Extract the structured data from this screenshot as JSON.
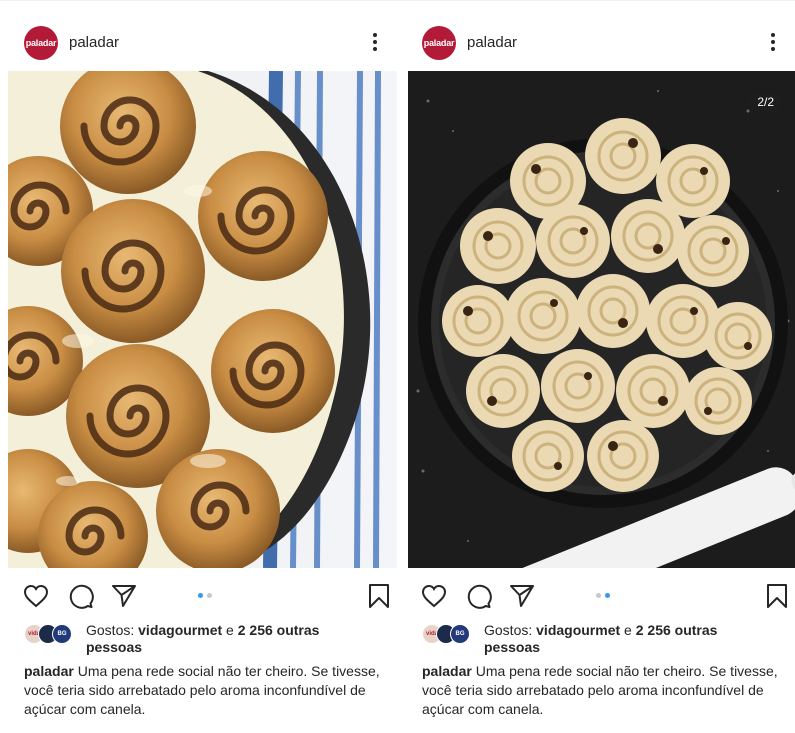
{
  "posts": [
    {
      "account": {
        "username": "paladar",
        "avatar_text": "paladar"
      },
      "image": {
        "description_icon": "cinnamon-rolls-baked-photo",
        "counter": ""
      },
      "carousel": {
        "active_index": 0,
        "total": 2
      },
      "likes": {
        "prefix": "Gostos: ",
        "user": "vidagourmet",
        "joiner": " e ",
        "others": "2 256 outras pessoas"
      },
      "caption": {
        "username": "paladar",
        "text": " Uma pena rede social não ter cheiro. Se tivesse, você teria sido arrebatado pelo aroma inconfundível de açúcar com canela."
      }
    },
    {
      "account": {
        "username": "paladar",
        "avatar_text": "paladar"
      },
      "image": {
        "description_icon": "cinnamon-rolls-raw-photo",
        "counter": "2/2"
      },
      "carousel": {
        "active_index": 1,
        "total": 2
      },
      "likes": {
        "prefix": "Gostos: ",
        "user": "vidagourmet",
        "joiner": " e ",
        "others": "2 256 outras pessoas"
      },
      "caption": {
        "username": "paladar",
        "text": " Uma pena rede social não ter cheiro. Se tivesse, você teria sido arrebatado pelo aroma inconfundível de açúcar com canela."
      }
    }
  ],
  "colors": {
    "brand": "#b31a38",
    "dot_active": "#3897f0",
    "dot_inactive": "#c7c7c7",
    "text": "#262626"
  },
  "icons": [
    "heart-icon",
    "comment-icon",
    "share-icon",
    "bookmark-icon",
    "more-options-icon"
  ]
}
